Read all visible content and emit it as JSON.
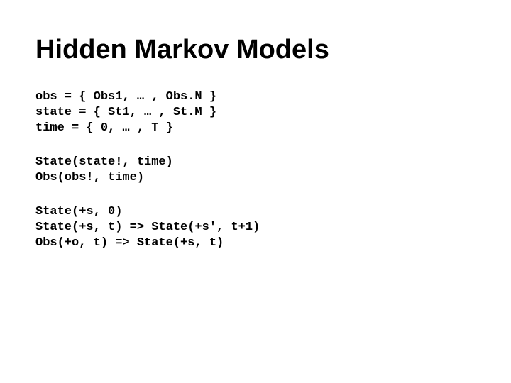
{
  "title": "Hidden Markov Models",
  "block1": {
    "l1": "obs = { Obs1, … , Obs.N }",
    "l2": "state = { St1, … , St.M }",
    "l3": "time = { 0, … , T }"
  },
  "block2": {
    "l1": "State(state!, time)",
    "l2": "Obs(obs!, time)"
  },
  "block3": {
    "l1": "State(+s, 0)",
    "l2": "State(+s, t) => State(+s', t+1)",
    "l3": "Obs(+o, t) => State(+s, t)"
  }
}
